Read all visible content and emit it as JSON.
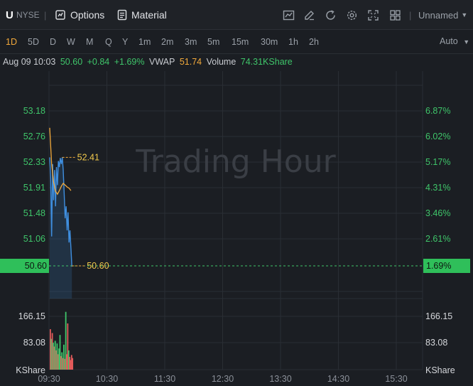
{
  "toolbar": {
    "symbol": "U",
    "exchange": "NYSE",
    "separator": "|",
    "options_label": "Options",
    "material_label": "Material",
    "layout_label": "Unnamed",
    "separator2": "|"
  },
  "periods": [
    "1D",
    "5D",
    "D",
    "W",
    "M",
    "Q",
    "Y",
    "1m",
    "2m",
    "3m",
    "5m",
    "15m",
    "30m",
    "1h",
    "2h"
  ],
  "active_period": "1D",
  "auto_label": "Auto",
  "info": {
    "datetime": "Aug 09 10:03",
    "price": "50.60",
    "change": "+0.84",
    "change_pct": "+1.69%",
    "vwap_label": "VWAP",
    "vwap": "51.74",
    "volume_label": "Volume",
    "volume": "74.31KShare"
  },
  "watermark": "Trading Hour",
  "colors": {
    "up": "#3fc56a",
    "down": "#e25a5a",
    "price_line": "#3f8fe0",
    "vwap_line": "#f2a93b",
    "grid": "#2a2e34"
  },
  "chart_data": {
    "type": "line",
    "price_axis_left": [
      "53.18",
      "52.76",
      "52.33",
      "51.91",
      "51.48",
      "51.06"
    ],
    "pct_axis_right": [
      "6.87%",
      "6.02%",
      "5.17%",
      "4.31%",
      "3.46%",
      "2.61%"
    ],
    "current_price": "50.60",
    "current_pct": "1.69%",
    "high_label": "52.41",
    "last_label": "50.60",
    "volume_axis": [
      "166.15",
      "83.08"
    ],
    "volume_unit": "KShare",
    "x_ticks": [
      "09:30",
      "10:30",
      "11:30",
      "12:30",
      "13:30",
      "14:30",
      "15:30"
    ],
    "ylim": [
      50.6,
      53.18
    ],
    "price_series": [
      {
        "t": 0,
        "v": 52.41
      },
      {
        "t": 1,
        "v": 52.05
      },
      {
        "t": 2,
        "v": 51.1
      },
      {
        "t": 3,
        "v": 52.3
      },
      {
        "t": 4,
        "v": 51.7
      },
      {
        "t": 5,
        "v": 52.2
      },
      {
        "t": 6,
        "v": 51.6
      },
      {
        "t": 7,
        "v": 52.25
      },
      {
        "t": 8,
        "v": 51.95
      },
      {
        "t": 9,
        "v": 52.35
      },
      {
        "t": 10,
        "v": 52.25
      },
      {
        "t": 11,
        "v": 52.4
      },
      {
        "t": 12,
        "v": 52.3
      },
      {
        "t": 13,
        "v": 52.41
      },
      {
        "t": 14,
        "v": 52.2
      },
      {
        "t": 15,
        "v": 51.8
      },
      {
        "t": 16,
        "v": 51.4
      },
      {
        "t": 17,
        "v": 51.6
      },
      {
        "t": 18,
        "v": 51.2
      },
      {
        "t": 19,
        "v": 51.5
      },
      {
        "t": 20,
        "v": 51.0
      },
      {
        "t": 21,
        "v": 51.2
      },
      {
        "t": 22,
        "v": 50.9
      },
      {
        "t": 23,
        "v": 50.6
      }
    ],
    "vwap_series": [
      {
        "t": 0,
        "v": 52.9
      },
      {
        "t": 2,
        "v": 52.3
      },
      {
        "t": 4,
        "v": 52.0
      },
      {
        "t": 6,
        "v": 51.85
      },
      {
        "t": 8,
        "v": 51.8
      },
      {
        "t": 10,
        "v": 51.86
      },
      {
        "t": 12,
        "v": 51.93
      },
      {
        "t": 14,
        "v": 51.98
      },
      {
        "t": 16,
        "v": 51.95
      },
      {
        "t": 18,
        "v": 51.92
      },
      {
        "t": 20,
        "v": 51.9
      },
      {
        "t": 22,
        "v": 51.86
      }
    ],
    "volume_series": [
      {
        "t": 0,
        "v": 105,
        "up": false
      },
      {
        "t": 1,
        "v": 80,
        "up": true
      },
      {
        "t": 2,
        "v": 95,
        "up": false
      },
      {
        "t": 3,
        "v": 70,
        "up": true
      },
      {
        "t": 4,
        "v": 60,
        "up": false
      },
      {
        "t": 5,
        "v": 75,
        "up": true
      },
      {
        "t": 6,
        "v": 50,
        "up": false
      },
      {
        "t": 7,
        "v": 68,
        "up": true
      },
      {
        "t": 8,
        "v": 40,
        "up": false
      },
      {
        "t": 9,
        "v": 55,
        "up": true
      },
      {
        "t": 10,
        "v": 90,
        "up": true
      },
      {
        "t": 11,
        "v": 35,
        "up": false
      },
      {
        "t": 12,
        "v": 45,
        "up": true
      },
      {
        "t": 13,
        "v": 30,
        "up": false
      },
      {
        "t": 14,
        "v": 65,
        "up": true
      },
      {
        "t": 15,
        "v": 28,
        "up": false
      },
      {
        "t": 16,
        "v": 150,
        "up": true
      },
      {
        "t": 17,
        "v": 40,
        "up": false
      },
      {
        "t": 18,
        "v": 120,
        "up": false
      },
      {
        "t": 19,
        "v": 50,
        "up": true
      },
      {
        "t": 20,
        "v": 33,
        "up": false
      },
      {
        "t": 21,
        "v": 25,
        "up": false
      },
      {
        "t": 22,
        "v": 38,
        "up": false
      },
      {
        "t": 23,
        "v": 30,
        "up": false
      }
    ],
    "volume_max": 166.15,
    "grid": true
  }
}
